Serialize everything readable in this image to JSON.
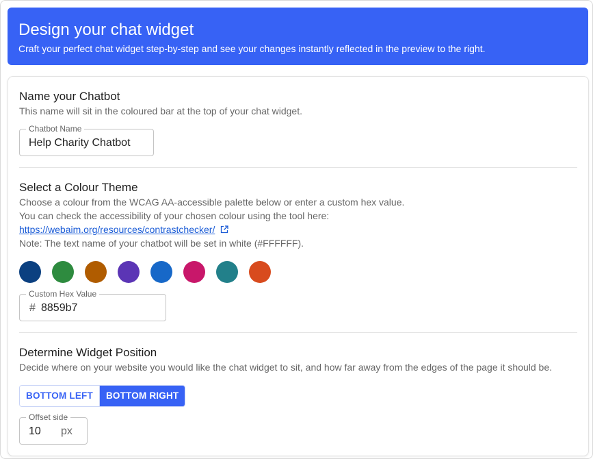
{
  "banner": {
    "title": "Design your chat widget",
    "subtitle": "Craft your perfect chat widget step-by-step and see your changes instantly reflected in the preview to the right."
  },
  "name_section": {
    "heading": "Name your Chatbot",
    "description": "This name will sit in the coloured bar at the top of your chat widget.",
    "field_label": "Chatbot Name",
    "field_value": "Help Charity Chatbot"
  },
  "colour_section": {
    "heading": "Select a Colour Theme",
    "line1": "Choose a colour from the WCAG AA-accessible palette below or enter a custom hex value.",
    "line2": "You can check the accessibility of your chosen colour using the tool here:",
    "link_text": "https://webaim.org/resources/contrastchecker/",
    "link_icon": "external-link-icon",
    "note": "Note: The text name of your chatbot will be set in white (#FFFFFF).",
    "swatches": [
      "#0b4080",
      "#2e8b3f",
      "#b05c00",
      "#5b35b5",
      "#1768c8",
      "#c8176a",
      "#22808a",
      "#d84b1e"
    ],
    "hex_label": "Custom Hex Value",
    "hex_prefix": "#",
    "hex_value": "8859b7"
  },
  "position_section": {
    "heading": "Determine Widget Position",
    "description": "Decide where on your website you would like the chat widget to sit, and how far away from the edges of the page it should be.",
    "btn_left": "BOTTOM LEFT",
    "btn_right": "BOTTOM RIGHT",
    "selected": "BOTTOM RIGHT",
    "offset_label": "Offset side",
    "offset_value": "10",
    "offset_unit": "px"
  },
  "colors": {
    "accent": "#3762f5"
  }
}
